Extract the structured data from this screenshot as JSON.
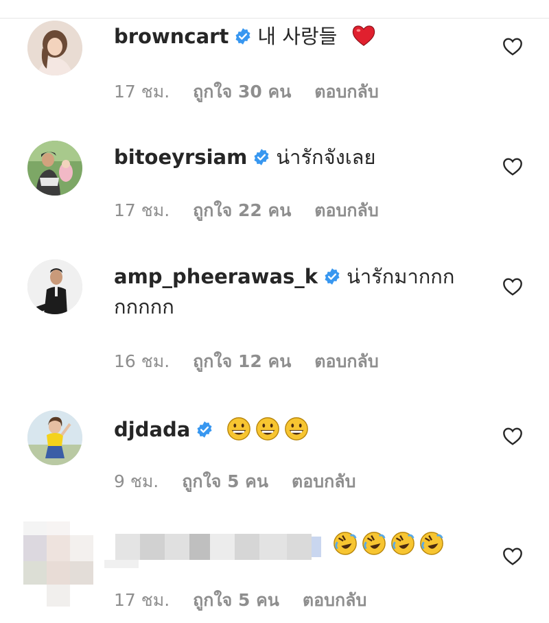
{
  "comments": [
    {
      "username": "browncart",
      "text": "내 사랑들",
      "emoji": [
        "red-heart"
      ],
      "time": "17 ชม.",
      "likes": "ถูกใจ 30 คน",
      "reply": "ตอบกลับ",
      "verified": true
    },
    {
      "username": "bitoeyrsiam",
      "text": "น่ารักจังเลย",
      "time": "17 ชม.",
      "likes": "ถูกใจ 22 คน",
      "reply": "ตอบกลับ",
      "verified": true
    },
    {
      "username": "amp_pheerawas_k",
      "text": "น่ารักมากกก",
      "text2": "กกกกก",
      "time": "16 ชม.",
      "likes": "ถูกใจ 12 คน",
      "reply": "ตอบกลับ",
      "verified": true
    },
    {
      "username": "djdada",
      "text": "",
      "emoji": [
        "grinning-face",
        "grinning-face",
        "grinning-face"
      ],
      "time": "9 ชม.",
      "likes": "ถูกใจ 5 คน",
      "reply": "ตอบกลับ",
      "verified": true
    },
    {
      "username": "",
      "text": "",
      "emoji": [
        "rolling-laughing-face",
        "rolling-laughing-face",
        "rolling-laughing-face",
        "rolling-laughing-face"
      ],
      "time": "17 ชม.",
      "likes": "ถูกใจ 5 คน",
      "reply": "ตอบกลับ",
      "verified": false
    }
  ],
  "colors": {
    "text": "#262626",
    "meta": "#8e8e8e",
    "verified": "#3897f0",
    "heart_emoji": "#e0202e",
    "emoji_yellow": "#f7c531"
  }
}
